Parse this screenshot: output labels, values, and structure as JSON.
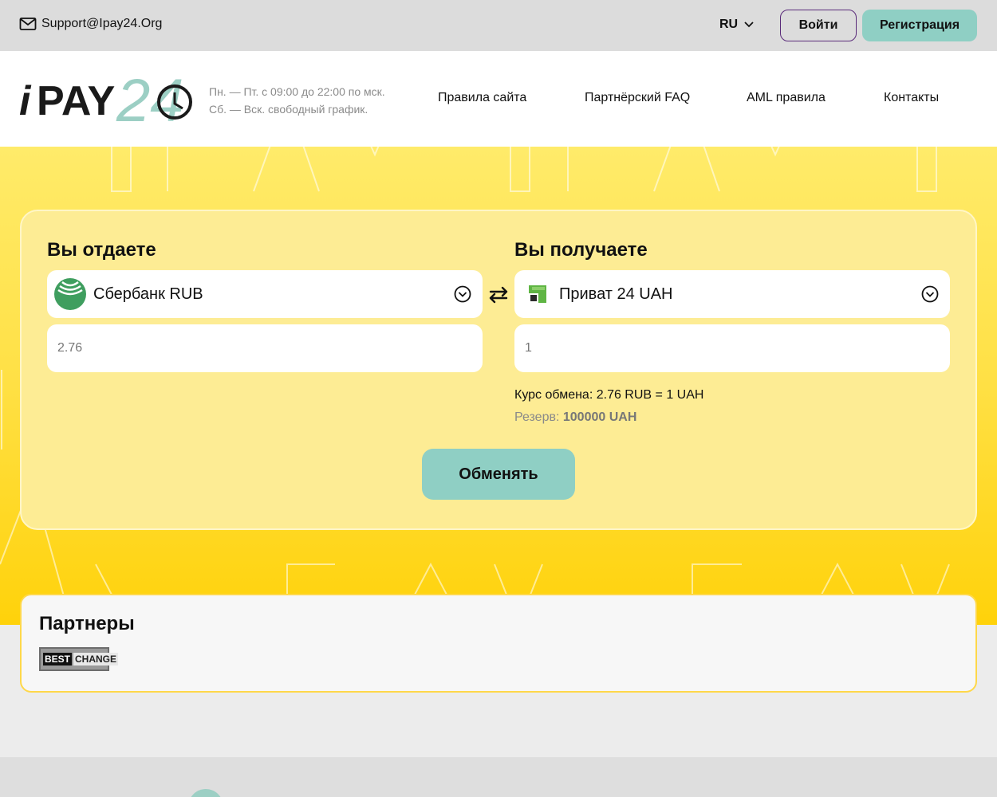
{
  "topbar": {
    "support_email": "Support@Ipay24.Org",
    "language": "RU",
    "login_label": "Войти",
    "register_label": "Регистрация"
  },
  "header": {
    "logo_text": "iPAY24",
    "hours_line1": "Пн. — Пт. с 09:00 до 22:00 по мск.",
    "hours_line2": "Сб. — Вск. свободный график.",
    "nav": [
      {
        "label": "Правила сайта"
      },
      {
        "label": "Партнёрский FAQ"
      },
      {
        "label": "AML правила"
      },
      {
        "label": "Контакты"
      }
    ]
  },
  "exchange": {
    "give": {
      "title": "Вы отдаете",
      "currency": "Сбербанк RUB",
      "amount": "2.76"
    },
    "get": {
      "title": "Вы получаете",
      "currency": "Приват 24 UAH",
      "amount": "1"
    },
    "rate_text": "Курс обмена: 2.76 RUB = 1 UAH",
    "reserve_label": "Резерв:",
    "reserve_value": "100000 UAH",
    "exchange_button": "Обменять"
  },
  "partners": {
    "title": "Партнеры",
    "logo_part1": "BEST",
    "logo_part2": "CHANGE"
  },
  "colors": {
    "accent": "#8fcfc4",
    "hero_top": "#ffeb6a",
    "hero_bottom": "#ffd20a",
    "card": "#fdec94",
    "login_border": "#5a2b7a"
  },
  "icons": [
    "mail-icon",
    "chevron-down-icon",
    "sberbank-logo-icon",
    "privat24-logo-icon",
    "swap-arrows-icon"
  ]
}
